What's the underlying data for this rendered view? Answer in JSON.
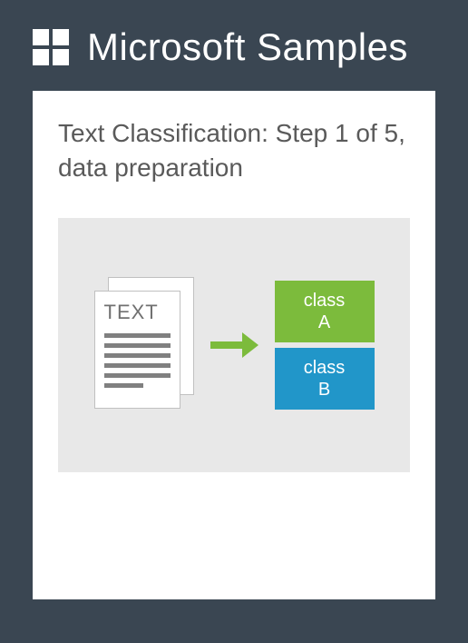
{
  "header": {
    "title": "Microsoft Samples"
  },
  "card": {
    "title": "Text Classification: Step 1 of 5, data preparation"
  },
  "diagram": {
    "doc_label": "TEXT",
    "class_a_line1": "class",
    "class_a_line2": "A",
    "class_b_line1": "class",
    "class_b_line2": "B"
  }
}
